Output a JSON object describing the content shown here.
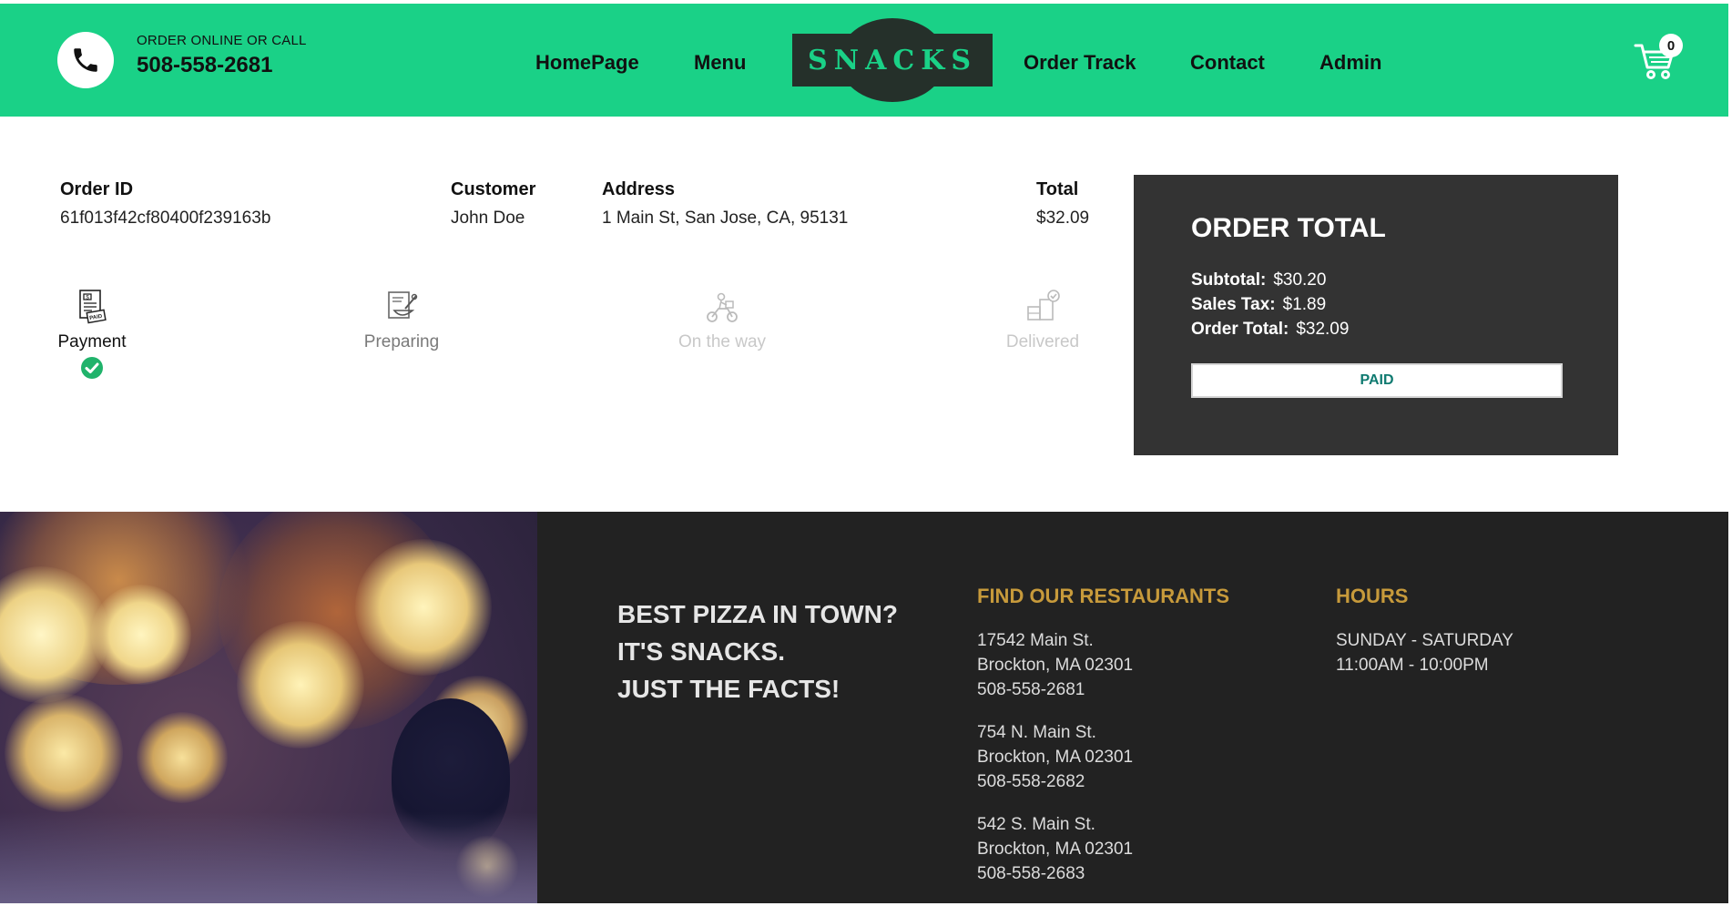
{
  "header": {
    "order_online_label": "ORDER ONLINE OR CALL",
    "phone": "508-558-2681",
    "nav": [
      "HomePage",
      "Menu",
      "Order Track",
      "Contact",
      "Admin"
    ],
    "logo_text": "SNACKS",
    "cart_count": "0",
    "icons": {
      "phone": "phone-icon",
      "cart": "cart-icon"
    }
  },
  "order": {
    "columns": [
      {
        "label": "Order ID",
        "value": "61f013f42cf80400f239163b"
      },
      {
        "label": "Customer",
        "value": "John Doe"
      },
      {
        "label": "Address",
        "value": "1 Main St, San Jose, CA, 95131"
      },
      {
        "label": "Total",
        "value": "$32.09"
      }
    ],
    "steps": [
      {
        "label": "Payment",
        "state": "done",
        "icon": "paid-receipt-icon"
      },
      {
        "label": "Preparing",
        "state": "in-progress",
        "icon": "preparing-icon"
      },
      {
        "label": "On the way",
        "state": "pending",
        "icon": "delivery-bike-icon"
      },
      {
        "label": "Delivered",
        "state": "pending",
        "icon": "delivered-box-icon"
      }
    ]
  },
  "summary": {
    "title": "ORDER TOTAL",
    "subtotal_label": "Subtotal:",
    "subtotal": "$30.20",
    "tax_label": "Sales Tax:",
    "tax": "$1.89",
    "total_label": "Order Total:",
    "total": "$32.09",
    "button_label": "PAID"
  },
  "footer": {
    "slogan": [
      "BEST PIZZA IN TOWN?",
      "IT'S SNACKS.",
      "JUST THE FACTS!"
    ],
    "restaurants_title": "FIND OUR RESTAURANTS",
    "restaurants": [
      {
        "street": "17542 Main St.",
        "city": "Brockton, MA 02301",
        "phone": "508-558-2681"
      },
      {
        "street": "754 N. Main St.",
        "city": "Brockton, MA 02301",
        "phone": "508-558-2682"
      },
      {
        "street": "542 S. Main St.",
        "city": "Brockton, MA 02301",
        "phone": "508-558-2683"
      }
    ],
    "hours_title": "HOURS",
    "hours_days": "SUNDAY - SATURDAY",
    "hours_time": "11:00AM - 10:00PM"
  },
  "colors": {
    "brand_green": "#1ad187",
    "dark_panel": "#333333",
    "footer_bg": "#222222",
    "gold": "#c79a3b",
    "check_green": "#20b36b"
  }
}
